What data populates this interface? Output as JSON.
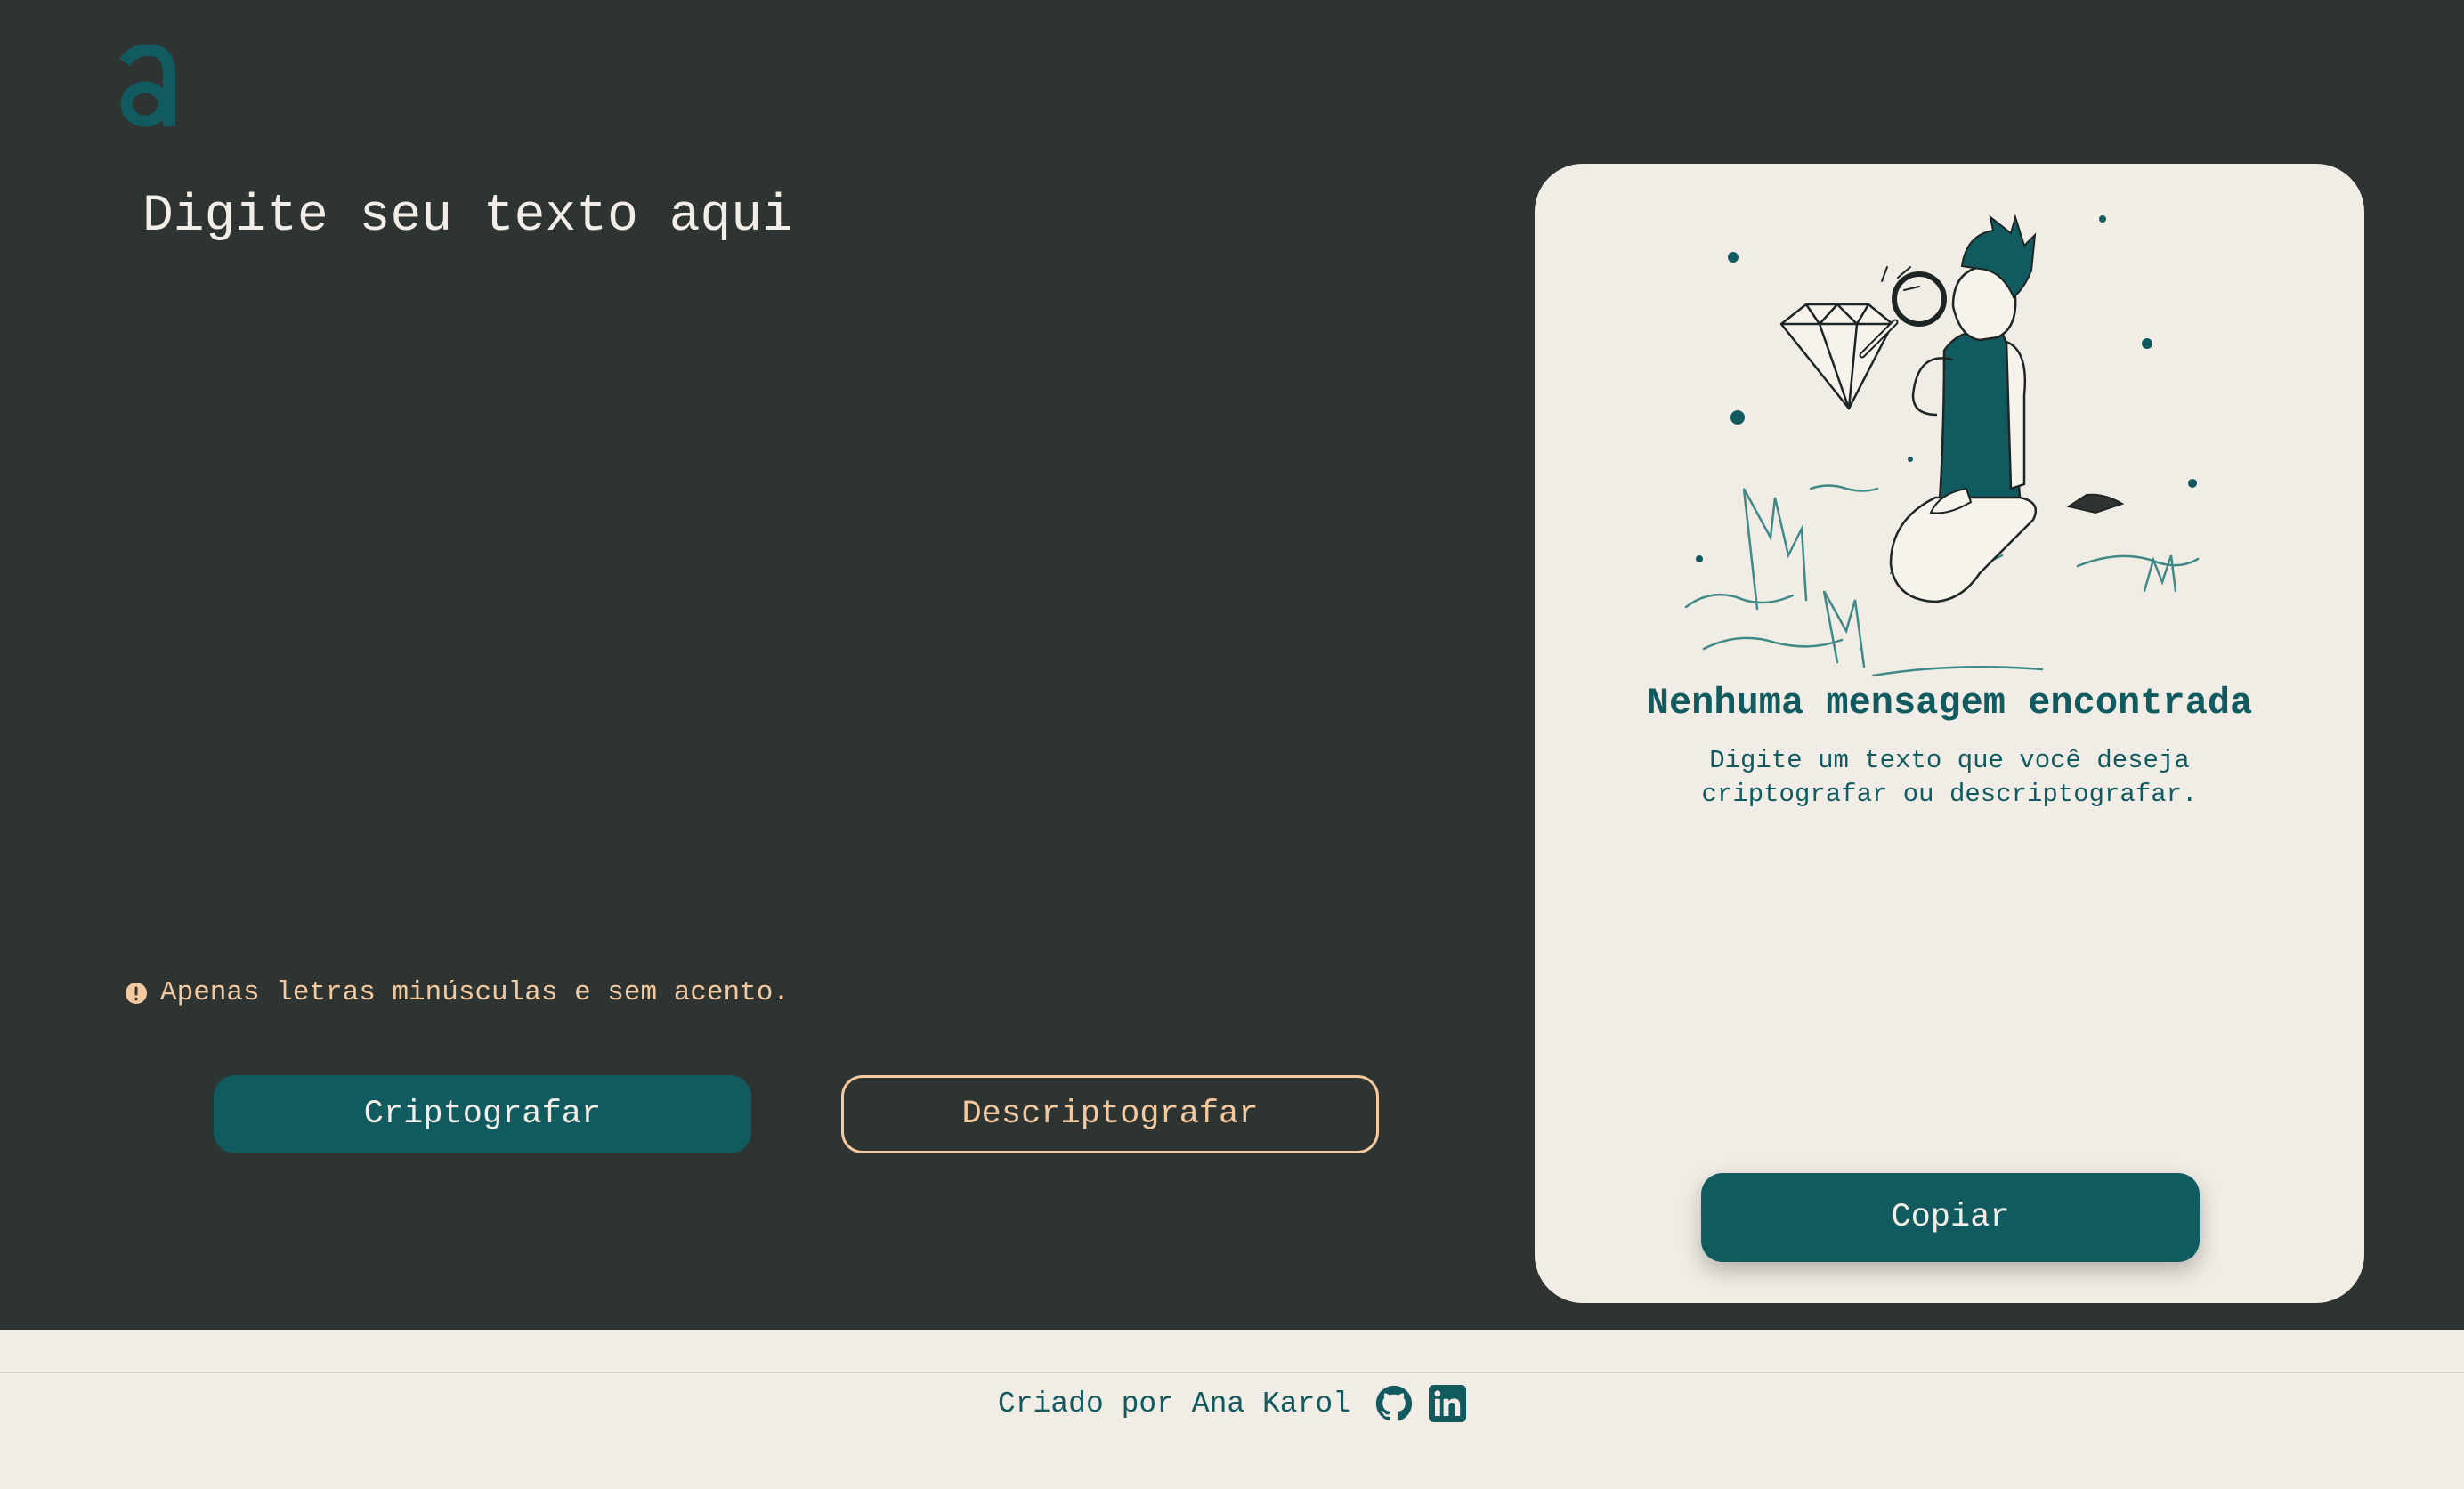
{
  "logo": {
    "glyph": "a",
    "icon": "logo-icon"
  },
  "input": {
    "placeholder": "Digite seu texto aqui"
  },
  "warning": {
    "icon": "exclamation-circle-icon",
    "text": "Apenas letras minúsculas e sem acento."
  },
  "buttons": {
    "encrypt": "Criptografar",
    "decrypt": "Descriptografar"
  },
  "output": {
    "title": "Nenhuma mensagem encontrada",
    "description": "Digite um texto que você deseja criptografar ou descriptografar.",
    "copy": "Copiar"
  },
  "footer": {
    "text": "Criado por Ana Karol",
    "icons": [
      "github-icon",
      "linkedin-icon"
    ]
  },
  "colors": {
    "background": "#2d3432",
    "accent": "#115b60",
    "card": "#f1ece5",
    "warning": "#f5c9a0",
    "text_light": "#f2ede6"
  }
}
